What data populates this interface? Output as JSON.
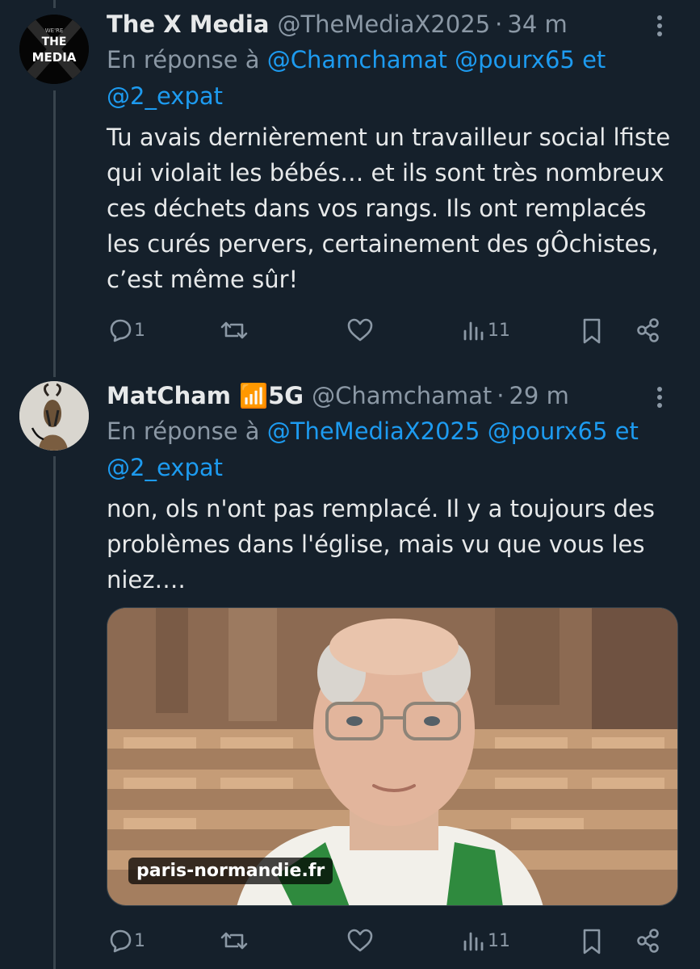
{
  "tweets": [
    {
      "author_name": "The X Media",
      "handle": "@TheMediaX2025",
      "separator": "·",
      "time": "34 m",
      "reply_prefix": "En réponse à",
      "reply_handles": [
        "@Chamchamat",
        "@pourx65",
        "et",
        "@2_expat"
      ],
      "body": "Tu avais dernièrement un travailleur social lfiste qui violait les bébés… et ils sont très nombreux ces déchets dans vos rangs. Ils ont remplacés les curés pervers, certainement des gÔchistes, c’est même sûr!",
      "replies": "1",
      "views": "11",
      "avatar_text": {
        "line1": "WE'RE",
        "line2": "THE",
        "line3": "MEDIA"
      }
    },
    {
      "author_name": "MatCham",
      "badge": "📶5G",
      "handle": "@Chamchamat",
      "separator": "·",
      "time": "29 m",
      "reply_prefix": "En réponse à",
      "reply_handles": [
        "@TheMediaX2025",
        "@pourx65",
        "et",
        "@2_expat"
      ],
      "body": "non, ols n'ont pas remplacé. Il y a toujours des problèmes dans l'église, mais vu que vous les niez….",
      "replies": "1",
      "views": "11",
      "media_source": "paris-normandie.fr"
    }
  ],
  "icons": [
    "more-icon",
    "reply-icon",
    "retweet-icon",
    "like-icon",
    "views-icon",
    "bookmark-icon",
    "share-icon"
  ],
  "colors": {
    "background": "#15202b",
    "text": "#e7e9ea",
    "muted": "#8b98a5",
    "link": "#1d9bf0"
  }
}
